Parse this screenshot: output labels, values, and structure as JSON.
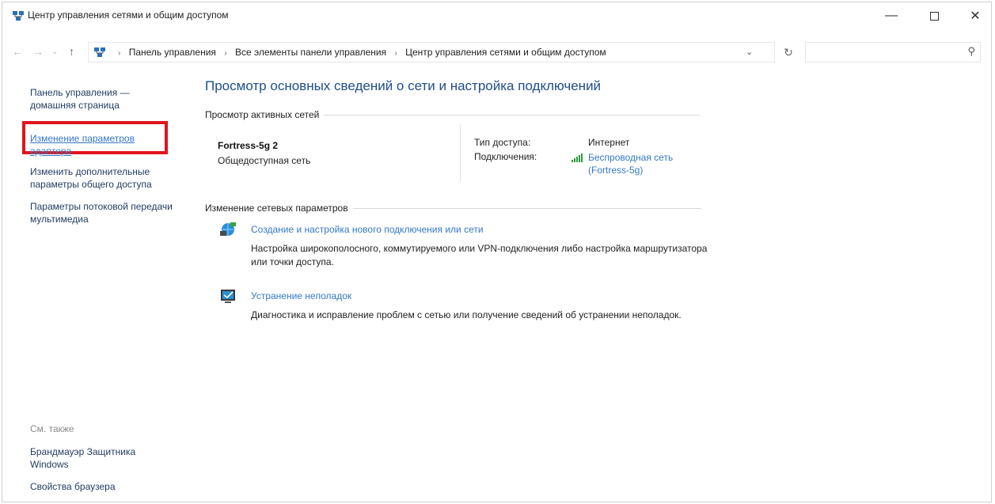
{
  "window": {
    "title": "Центр управления сетями и общим доступом",
    "minimize_icon": "minimize-icon",
    "maximize_icon": "maximize-icon",
    "close_icon": "close-icon"
  },
  "address_bar": {
    "breadcrumbs": [
      "Панель управления",
      "Все элементы панели управления",
      "Центр управления сетями и общим доступом"
    ],
    "search_placeholder": ""
  },
  "left_pane": {
    "home_link": "Панель управления — домашняя страница",
    "adapter_link": "Изменение параметров адаптера",
    "sharing_link": "Изменить дополнительные параметры общего доступа",
    "media_link": "Параметры потоковой передачи мультимедиа",
    "see_also_label": "См. также",
    "firewall_link": "Брандмауэр Защитника Windows",
    "browser_link": "Свойства браузера"
  },
  "main": {
    "heading": "Просмотр основных сведений о сети и настройка подключений",
    "active_networks_label": "Просмотр активных сетей",
    "network": {
      "name": "Fortress-5g 2",
      "category": "Общедоступная сеть",
      "access_type_label": "Тип доступа:",
      "access_type_value": "Интернет",
      "connections_label": "Подключения:",
      "connection_link": "Беспроводная сеть (Fortress-5g)"
    },
    "change_settings_label": "Изменение сетевых параметров",
    "tasks": [
      {
        "title": "Создание и настройка нового подключения или сети",
        "description": "Настройка широкополосного, коммутируемого или VPN-подключения либо настройка маршрутизатора или точки доступа."
      },
      {
        "title": "Устранение неполадок",
        "description": "Диагностика и исправление проблем с сетью или получение сведений об устранении неполадок."
      }
    ]
  },
  "colors": {
    "link": "#3478c6",
    "heading": "#1e4e8c",
    "highlight_border": "#e0141c"
  }
}
